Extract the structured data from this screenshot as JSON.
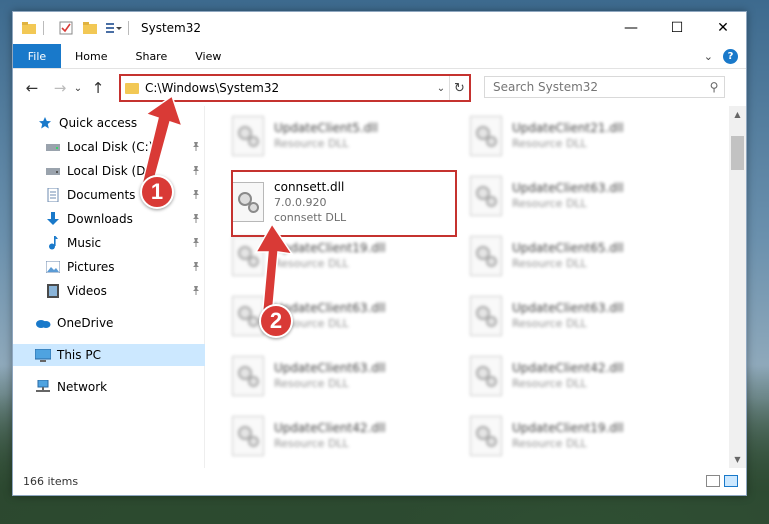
{
  "titlebar": {
    "title": "System32",
    "quick_access_icons": [
      "folder-icon",
      "properties-icon",
      "new-folder-icon",
      "customize-icon"
    ]
  },
  "window_controls": {
    "minimize": "—",
    "maximize": "☐",
    "close": "✕"
  },
  "ribbon": {
    "file": "File",
    "tabs": [
      "Home",
      "Share",
      "View"
    ],
    "collapse_glyph": "⌄",
    "help_glyph": "?"
  },
  "nav": {
    "back": "←",
    "forward": "→",
    "recent": "⌄",
    "up": "↑",
    "address": "C:\\Windows\\System32",
    "address_dropdown": "⌄",
    "refresh": "↻",
    "search_placeholder": "Search System32",
    "search_glyph": "⚲"
  },
  "sidebar": {
    "items": [
      {
        "label": "Quick access",
        "icon": "star-icon",
        "pinned": false
      },
      {
        "label": "Local Disk (C:)",
        "icon": "drive-icon",
        "pinned": true
      },
      {
        "label": "Local Disk (D:)",
        "icon": "drive-icon",
        "pinned": true
      },
      {
        "label": "Documents",
        "icon": "documents-icon",
        "pinned": true
      },
      {
        "label": "Downloads",
        "icon": "downloads-icon",
        "pinned": true
      },
      {
        "label": "Music",
        "icon": "music-icon",
        "pinned": true
      },
      {
        "label": "Pictures",
        "icon": "pictures-icon",
        "pinned": true
      },
      {
        "label": "Videos",
        "icon": "videos-icon",
        "pinned": true
      },
      {
        "label": "OneDrive",
        "icon": "cloud-icon",
        "pinned": false
      },
      {
        "label": "This PC",
        "icon": "computer-icon",
        "pinned": false,
        "selected": true
      },
      {
        "label": "Network",
        "icon": "network-icon",
        "pinned": false
      }
    ],
    "pin_glyph": "📌"
  },
  "files": {
    "left": [
      {
        "name": "UpdateClient5.dll",
        "sub": "Resource DLL",
        "blurred": true
      },
      {
        "name": "connsett.dll",
        "version": "7.0.0.920",
        "sub": "connsett DLL",
        "blurred": false
      },
      {
        "name": "UpdateClient19.dll",
        "sub": "Resource DLL",
        "blurred": true
      },
      {
        "name": "UpdateClient63.dll",
        "sub": "Resource DLL",
        "blurred": true
      },
      {
        "name": "UpdateClient63.dll",
        "sub": "Resource DLL",
        "blurred": true
      },
      {
        "name": "UpdateClient42.dll",
        "sub": "Resource DLL",
        "blurred": true
      }
    ],
    "right": [
      {
        "name": "UpdateClient21.dll",
        "sub": "Resource DLL"
      },
      {
        "name": "UpdateClient63.dll",
        "sub": "Resource DLL"
      },
      {
        "name": "UpdateClient65.dll",
        "sub": "Resource DLL"
      },
      {
        "name": "UpdateClient63.dll",
        "sub": "Resource DLL"
      },
      {
        "name": "UpdateClient42.dll",
        "sub": "Resource DLL"
      },
      {
        "name": "UpdateClient19.dll",
        "sub": "Resource DLL"
      }
    ]
  },
  "status": {
    "item_count": "166 items"
  },
  "annotations": {
    "badge1": "1",
    "badge2": "2"
  },
  "colors": {
    "accent": "#1979ca",
    "annotation_red": "#d93a36",
    "selected_bg": "#cce8ff"
  }
}
